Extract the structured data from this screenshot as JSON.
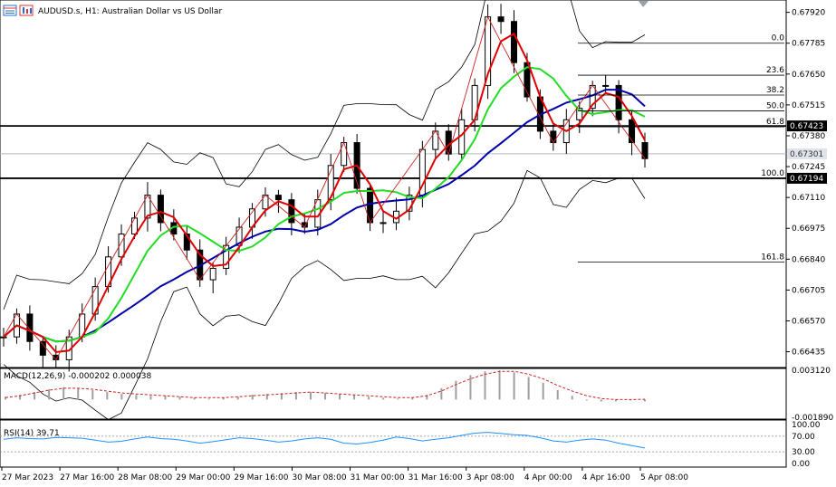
{
  "header": {
    "symbol_title": "AUDUSD.s, H1:  Australian Dollar vs US Dollar"
  },
  "indicators": {
    "macd_label": "MACD(12,26,9) -0.000202 0.000038",
    "rsi_label": "RSI(14) 39.71"
  },
  "colors": {
    "candle": "#000000",
    "ma_fast": "#e00000",
    "ma_mid": "#22dd22",
    "ma_slow": "#0000aa",
    "bollinger": "#000000",
    "zigzag": "#cc2222",
    "macd_hist": "#a0a0a0",
    "macd_signal": "#cc2222",
    "rsi_line": "#1e90ff",
    "price_line": "#b0b8c8",
    "highlight_box": "#000000"
  },
  "icons": [
    "chart-grid-icon",
    "bar-chart-icon"
  ],
  "chart_data": {
    "type": "line",
    "instrument": "AUDUSD.s",
    "timeframe": "H1",
    "price_axis_ticks": [
      "0.67920",
      "0.67785",
      "0.67650",
      "0.67515",
      "0.67380",
      "0.67245",
      "0.67110",
      "0.66975",
      "0.66840",
      "0.66705",
      "0.66570",
      "0.66435"
    ],
    "ylim": [
      0.6637,
      0.6797
    ],
    "time_axis_ticks": [
      "27 Mar 2023",
      "27 Mar 16:00",
      "28 Mar 08:00",
      "29 Mar 00:00",
      "29 Mar 16:00",
      "30 Mar 08:00",
      "31 Mar 00:00",
      "31 Mar 16:00",
      "3 Apr 08:00",
      "4 Apr 00:00",
      "4 Apr 16:00",
      "5 Apr 08:00"
    ],
    "price_labels": [
      {
        "text": "0.67423",
        "boxed": true
      },
      {
        "text": "0.67301",
        "boxed": false
      },
      {
        "text": "0.67194",
        "boxed": true
      }
    ],
    "fibonacci": {
      "levels": [
        {
          "label": "0.0",
          "price": 0.67785
        },
        {
          "label": "23.6",
          "price": 0.67645
        },
        {
          "label": "38.2",
          "price": 0.67558
        },
        {
          "label": "50.0",
          "price": 0.67489
        },
        {
          "label": "61.8",
          "price": 0.67419
        },
        {
          "label": "100.0",
          "price": 0.67194
        },
        {
          "label": "161.8",
          "price": 0.66827
        }
      ]
    },
    "horizontal_lines": [
      0.67423,
      0.67194,
      0.67301
    ],
    "close_series": [
      0.665,
      0.666,
      0.6648,
      0.6642,
      0.664,
      0.665,
      0.666,
      0.6672,
      0.6685,
      0.6695,
      0.6702,
      0.6712,
      0.67,
      0.6695,
      0.6688,
      0.6675,
      0.668,
      0.669,
      0.6698,
      0.6706,
      0.6712,
      0.671,
      0.67,
      0.6698,
      0.671,
      0.6725,
      0.6735,
      0.6715,
      0.67,
      0.67,
      0.6705,
      0.6712,
      0.6732,
      0.674,
      0.673,
      0.6745,
      0.676,
      0.679,
      0.6788,
      0.677,
      0.6755,
      0.674,
      0.6735,
      0.6745,
      0.675,
      0.676,
      0.676,
      0.6745,
      0.6735,
      0.6728
    ],
    "macd": {
      "axis_ticks": [
        "0.003120",
        "-0.001890"
      ],
      "range": [
        -0.00189,
        0.00312
      ],
      "histogram": [
        0.0003,
        0.0005,
        0.0008,
        0.0011,
        0.0013,
        0.0012,
        0.001,
        0.0008,
        0.0006,
        0.0005,
        0.0004,
        0.0004,
        0.0003,
        0.0002,
        0.0001,
        0.0002,
        0.0003,
        0.0005,
        0.0006,
        0.0007,
        0.0008,
        0.0008,
        0.0007,
        0.0006,
        0.0005,
        0.0003,
        0.0002,
        0.0001,
        0.0002,
        0.0005,
        0.0012,
        0.002,
        0.0026,
        0.003,
        0.0031,
        0.0029,
        0.0024,
        0.0018,
        0.001,
        0.0004,
        -0.0001,
        -0.0002,
        -0.0002,
        -0.0001,
        -0.0002
      ],
      "signal": [
        0.0002,
        0.0004,
        0.0007,
        0.001,
        0.0012,
        0.0012,
        0.0011,
        0.0009,
        0.0007,
        0.0006,
        0.0005,
        0.0004,
        0.0003,
        0.0002,
        0.0002,
        0.0002,
        0.0003,
        0.0004,
        0.0005,
        0.0006,
        0.0007,
        0.0008,
        0.0007,
        0.0006,
        0.0005,
        0.0004,
        0.0003,
        0.0002,
        0.0002,
        0.0004,
        0.0009,
        0.0016,
        0.0022,
        0.0027,
        0.003,
        0.003,
        0.0027,
        0.0022,
        0.0015,
        0.0009,
        0.0004,
        0.0001,
        0.0,
        0.0,
        4e-05
      ]
    },
    "rsi": {
      "axis_ticks": [
        "100.00",
        "70.00",
        "30.00",
        "0.00"
      ],
      "range": [
        0,
        100
      ],
      "levels": [
        70,
        30
      ],
      "values": [
        62,
        66,
        64,
        63,
        67,
        66,
        65,
        60,
        55,
        57,
        63,
        68,
        64,
        62,
        58,
        52,
        56,
        61,
        66,
        64,
        60,
        55,
        58,
        63,
        66,
        62,
        52,
        50,
        54,
        60,
        68,
        64,
        58,
        62,
        66,
        72,
        78,
        80,
        77,
        74,
        72,
        66,
        58,
        55,
        60,
        63,
        60,
        52,
        46,
        39.71
      ]
    }
  }
}
